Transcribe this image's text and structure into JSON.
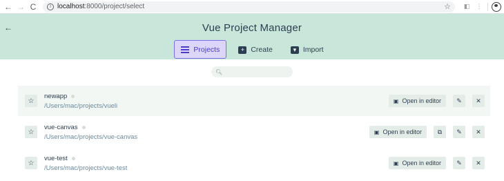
{
  "browser": {
    "url_host": "localhost",
    "url_path": ":8000/project/select"
  },
  "header": {
    "title": "Vue Project Manager"
  },
  "tabs": [
    {
      "label": "Projects"
    },
    {
      "label": "Create"
    },
    {
      "label": "Import"
    }
  ],
  "search": {
    "placeholder": "",
    "value": ""
  },
  "projects": [
    {
      "name": "newapp",
      "path": "/Users/mac/projects/vueli",
      "open_label": "Open in editor"
    },
    {
      "name": "vue-canvas",
      "path": "/Users/mac/projects/vue-canvas",
      "open_label": "Open in editor"
    },
    {
      "name": "vue-test",
      "path": "/Users/mac/projects/vue-test",
      "open_label": "Open in editor"
    }
  ],
  "colors": {
    "header_bg": "#c8e6d9",
    "accent": "#7d6ce6",
    "text": "#2c3e50",
    "path": "#6a8aa0"
  }
}
